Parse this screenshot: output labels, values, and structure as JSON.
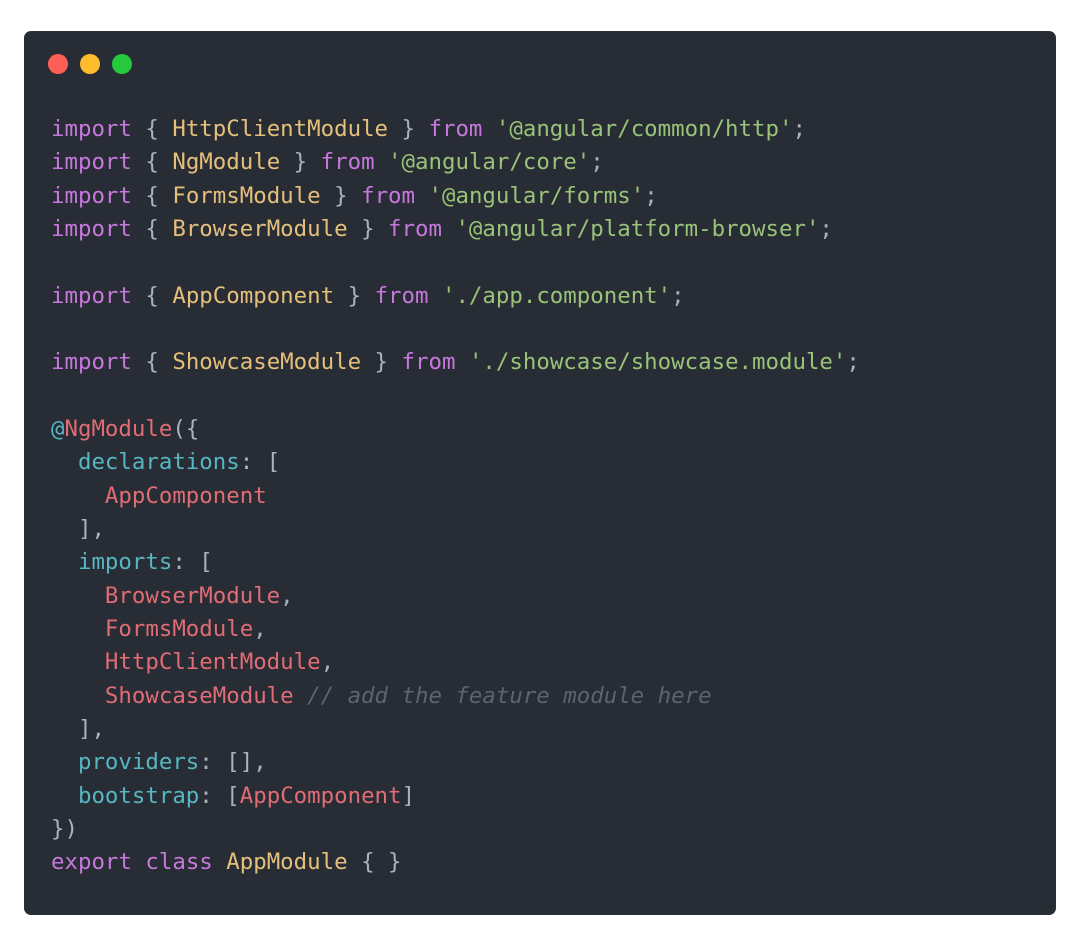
{
  "window": {
    "controls": [
      {
        "name": "close",
        "color": "#ff5f56"
      },
      {
        "name": "minimize",
        "color": "#ffbd2e"
      },
      {
        "name": "maximize",
        "color": "#27c93f"
      }
    ],
    "background": "#282c34"
  },
  "code": {
    "language": "typescript",
    "lines": [
      [
        [
          "kw",
          "import"
        ],
        [
          "pun",
          " { "
        ],
        [
          "cls",
          "HttpClientModule"
        ],
        [
          "pun",
          " } "
        ],
        [
          "kw",
          "from"
        ],
        [
          "pun",
          " "
        ],
        [
          "str",
          "'@angular/common/http'"
        ],
        [
          "pun",
          ";"
        ]
      ],
      [
        [
          "kw",
          "import"
        ],
        [
          "pun",
          " { "
        ],
        [
          "cls",
          "NgModule"
        ],
        [
          "pun",
          " } "
        ],
        [
          "kw",
          "from"
        ],
        [
          "pun",
          " "
        ],
        [
          "str",
          "'@angular/core'"
        ],
        [
          "pun",
          ";"
        ]
      ],
      [
        [
          "kw",
          "import"
        ],
        [
          "pun",
          " { "
        ],
        [
          "cls",
          "FormsModule"
        ],
        [
          "pun",
          " } "
        ],
        [
          "kw",
          "from"
        ],
        [
          "pun",
          " "
        ],
        [
          "str",
          "'@angular/forms'"
        ],
        [
          "pun",
          ";"
        ]
      ],
      [
        [
          "kw",
          "import"
        ],
        [
          "pun",
          " { "
        ],
        [
          "cls",
          "BrowserModule"
        ],
        [
          "pun",
          " } "
        ],
        [
          "kw",
          "from"
        ],
        [
          "pun",
          " "
        ],
        [
          "str",
          "'@angular/platform-browser'"
        ],
        [
          "pun",
          ";"
        ]
      ],
      [],
      [
        [
          "kw",
          "import"
        ],
        [
          "pun",
          " { "
        ],
        [
          "cls",
          "AppComponent"
        ],
        [
          "pun",
          " } "
        ],
        [
          "kw",
          "from"
        ],
        [
          "pun",
          " "
        ],
        [
          "str",
          "'./app.component'"
        ],
        [
          "pun",
          ";"
        ]
      ],
      [],
      [
        [
          "kw",
          "import"
        ],
        [
          "pun",
          " { "
        ],
        [
          "cls",
          "ShowcaseModule"
        ],
        [
          "pun",
          " } "
        ],
        [
          "kw",
          "from"
        ],
        [
          "pun",
          " "
        ],
        [
          "str",
          "'./showcase/showcase.module'"
        ],
        [
          "pun",
          ";"
        ]
      ],
      [],
      [
        [
          "prop",
          "@"
        ],
        [
          "red",
          "NgModule"
        ],
        [
          "pun",
          "({"
        ]
      ],
      [
        [
          "pun",
          "  "
        ],
        [
          "prop",
          "declarations"
        ],
        [
          "pun",
          ": ["
        ]
      ],
      [
        [
          "pun",
          "    "
        ],
        [
          "red",
          "AppComponent"
        ]
      ],
      [
        [
          "pun",
          "  ],"
        ]
      ],
      [
        [
          "pun",
          "  "
        ],
        [
          "prop",
          "imports"
        ],
        [
          "pun",
          ": ["
        ]
      ],
      [
        [
          "pun",
          "    "
        ],
        [
          "red",
          "BrowserModule"
        ],
        [
          "pun",
          ","
        ]
      ],
      [
        [
          "pun",
          "    "
        ],
        [
          "red",
          "FormsModule"
        ],
        [
          "pun",
          ","
        ]
      ],
      [
        [
          "pun",
          "    "
        ],
        [
          "red",
          "HttpClientModule"
        ],
        [
          "pun",
          ","
        ]
      ],
      [
        [
          "pun",
          "    "
        ],
        [
          "red",
          "ShowcaseModule"
        ],
        [
          "pun",
          " "
        ],
        [
          "com",
          "// add the feature module here"
        ]
      ],
      [
        [
          "pun",
          "  ],"
        ]
      ],
      [
        [
          "pun",
          "  "
        ],
        [
          "prop",
          "providers"
        ],
        [
          "pun",
          ": [],"
        ]
      ],
      [
        [
          "pun",
          "  "
        ],
        [
          "prop",
          "bootstrap"
        ],
        [
          "pun",
          ": ["
        ],
        [
          "red",
          "AppComponent"
        ],
        [
          "pun",
          "]"
        ]
      ],
      [
        [
          "pun",
          "})"
        ]
      ],
      [
        [
          "kw",
          "export"
        ],
        [
          "pun",
          " "
        ],
        [
          "kw",
          "class"
        ],
        [
          "pun",
          " "
        ],
        [
          "cls",
          "AppModule"
        ],
        [
          "pun",
          " { }"
        ]
      ]
    ]
  }
}
